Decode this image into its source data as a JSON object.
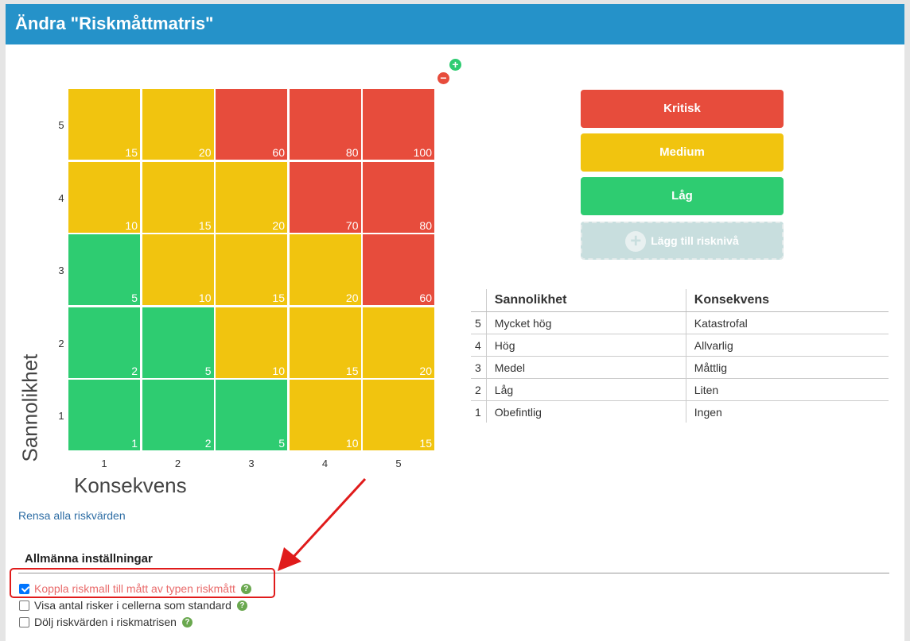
{
  "dialog": {
    "title": "Ändra \"Riskmåttmatris\""
  },
  "matrix": {
    "y_axis_label": "Sannolikhet",
    "x_axis_label": "Konsekvens",
    "row_labels": [
      "5",
      "4",
      "3",
      "2",
      "1"
    ],
    "col_labels": [
      "1",
      "2",
      "3",
      "4",
      "5"
    ],
    "rows": [
      [
        {
          "value": "15",
          "level": "medium"
        },
        {
          "value": "20",
          "level": "medium"
        },
        {
          "value": "60",
          "level": "kritisk"
        },
        {
          "value": "80",
          "level": "kritisk"
        },
        {
          "value": "100",
          "level": "kritisk"
        }
      ],
      [
        {
          "value": "10",
          "level": "medium"
        },
        {
          "value": "15",
          "level": "medium"
        },
        {
          "value": "20",
          "level": "medium"
        },
        {
          "value": "70",
          "level": "kritisk"
        },
        {
          "value": "80",
          "level": "kritisk"
        }
      ],
      [
        {
          "value": "5",
          "level": "lag"
        },
        {
          "value": "10",
          "level": "medium"
        },
        {
          "value": "15",
          "level": "medium"
        },
        {
          "value": "20",
          "level": "medium"
        },
        {
          "value": "60",
          "level": "kritisk"
        }
      ],
      [
        {
          "value": "2",
          "level": "lag"
        },
        {
          "value": "5",
          "level": "lag"
        },
        {
          "value": "10",
          "level": "medium"
        },
        {
          "value": "15",
          "level": "medium"
        },
        {
          "value": "20",
          "level": "medium"
        }
      ],
      [
        {
          "value": "1",
          "level": "lag"
        },
        {
          "value": "2",
          "level": "lag"
        },
        {
          "value": "5",
          "level": "lag"
        },
        {
          "value": "10",
          "level": "medium"
        },
        {
          "value": "15",
          "level": "medium"
        }
      ]
    ],
    "add_icon": "plus-icon",
    "remove_icon": "minus-icon",
    "add_symbol": "+",
    "remove_symbol": "−"
  },
  "levels": [
    {
      "label": "Kritisk",
      "color": "#e74c3c"
    },
    {
      "label": "Medium",
      "color": "#f1c40f"
    },
    {
      "label": "Låg",
      "color": "#2ecc71"
    }
  ],
  "add_level": {
    "label": "Lägg till risknivå",
    "icon": "plus-circle-icon",
    "symbol": "+"
  },
  "scale_table": {
    "headers": {
      "col1": "Sannolikhet",
      "col2": "Konsekvens"
    },
    "rows": [
      {
        "num": "5",
        "sannolikhet": "Mycket hög",
        "konsekvens": "Katastrofal"
      },
      {
        "num": "4",
        "sannolikhet": "Hög",
        "konsekvens": "Allvarlig"
      },
      {
        "num": "3",
        "sannolikhet": "Medel",
        "konsekvens": "Måttlig"
      },
      {
        "num": "2",
        "sannolikhet": "Låg",
        "konsekvens": "Liten"
      },
      {
        "num": "1",
        "sannolikhet": "Obefintlig",
        "konsekvens": "Ingen"
      }
    ]
  },
  "clear_link": "Rensa alla riskvärden",
  "settings": {
    "title": "Allmänna inställningar",
    "help_symbol": "?",
    "options": [
      {
        "label": "Koppla riskmall till mått av typen riskmått",
        "checked": true
      },
      {
        "label": "Visa antal risker i cellerna som standard",
        "checked": false
      },
      {
        "label": "Dölj riskvärden i riskmatrisen",
        "checked": false
      }
    ]
  },
  "colors": {
    "header": "#2592c9",
    "kritisk": "#e74c3c",
    "medium": "#f1c40f",
    "lag": "#2ecc71",
    "annotation": "#e01b1b"
  }
}
